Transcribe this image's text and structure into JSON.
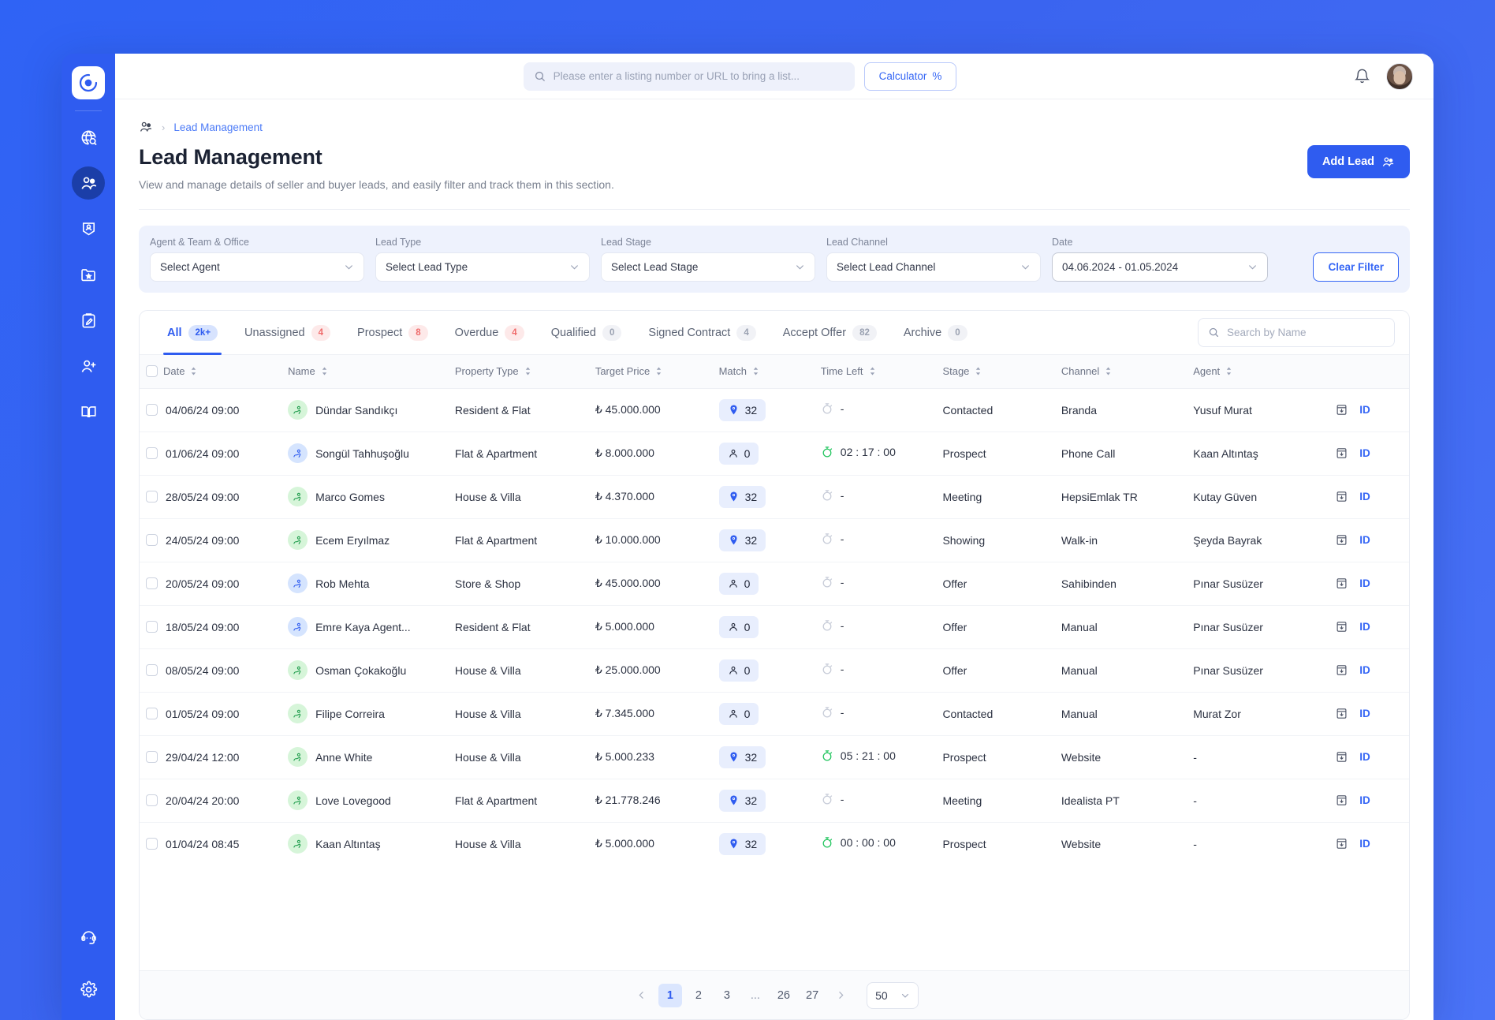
{
  "brand": {
    "logo_icon": "target-logo-icon"
  },
  "sidebar": {
    "items": [
      {
        "name": "sidebar-item-discover",
        "icon": "globe-search-icon",
        "active": false
      },
      {
        "name": "sidebar-item-leads",
        "icon": "users-icon",
        "active": true
      },
      {
        "name": "sidebar-item-portfolio",
        "icon": "badge-person-icon",
        "active": false
      },
      {
        "name": "sidebar-item-favorites",
        "icon": "folder-star-icon",
        "active": false
      },
      {
        "name": "sidebar-item-notes",
        "icon": "clipboard-edit-icon",
        "active": false
      },
      {
        "name": "sidebar-item-add-user",
        "icon": "user-plus-icon",
        "active": false
      },
      {
        "name": "sidebar-item-library",
        "icon": "book-icon",
        "active": false
      }
    ],
    "bottom": [
      {
        "name": "sidebar-item-support",
        "icon": "headset-icon"
      },
      {
        "name": "sidebar-item-settings",
        "icon": "gear-icon"
      }
    ]
  },
  "topbar": {
    "search": {
      "value": "",
      "placeholder": "Please enter a listing number or URL to bring a list..."
    },
    "calculator_label": "Calculator",
    "calculator_symbol": "%",
    "notification_icon": "bell-icon",
    "avatar_icon": "user-avatar"
  },
  "breadcrumb": {
    "icon": "users-icon",
    "separator": "›",
    "current": "Lead Management"
  },
  "page": {
    "title": "Lead Management",
    "subtitle": "View and manage details of seller and buyer leads, and easily filter and track them in this section.",
    "add_lead_label": "Add Lead"
  },
  "filters": {
    "agent": {
      "label": "Agent & Team & Office",
      "value": "Select Agent"
    },
    "type": {
      "label": "Lead Type",
      "value": "Select Lead Type"
    },
    "stage": {
      "label": "Lead Stage",
      "value": "Select Lead Stage"
    },
    "channel": {
      "label": "Lead Channel",
      "value": "Select Lead Channel"
    },
    "date": {
      "label": "Date",
      "value": "04.06.2024 - 01.05.2024"
    },
    "clear_label": "Clear Filter"
  },
  "tabs": [
    {
      "label": "All",
      "count": "2k+",
      "style": "blue",
      "active": true
    },
    {
      "label": "Unassigned",
      "count": "4",
      "style": "red",
      "active": false
    },
    {
      "label": "Prospect",
      "count": "8",
      "style": "red",
      "active": false
    },
    {
      "label": "Overdue",
      "count": "4",
      "style": "red",
      "active": false
    },
    {
      "label": "Qualified",
      "count": "0",
      "style": "gray",
      "active": false
    },
    {
      "label": "Signed Contract",
      "count": "4",
      "style": "gray",
      "active": false
    },
    {
      "label": "Accept Offer",
      "count": "82",
      "style": "gray",
      "active": false
    },
    {
      "label": "Archive",
      "count": "0",
      "style": "gray",
      "active": false
    }
  ],
  "table_search": {
    "value": "",
    "placeholder": "Search by Name"
  },
  "table": {
    "columns": [
      "Date",
      "Name",
      "Property Type",
      "Target Price",
      "Match",
      "Time Left",
      "Stage",
      "Channel",
      "Agent"
    ],
    "id_label": "ID",
    "rows": [
      {
        "date": "04/06/24 09:00",
        "name": "Dündar Sandıkçı",
        "lead_type": "seller",
        "property": "Resident & Flat",
        "price": "₺ 45.000.000",
        "match": "32",
        "match_icon": "pin-icon",
        "time": "-",
        "timer_active": false,
        "stage": "Contacted",
        "channel": "Branda",
        "agent": "Yusuf Murat"
      },
      {
        "date": "01/06/24 09:00",
        "name": "Songül Tahhuşoğlu",
        "lead_type": "buyer",
        "property": "Flat & Apartment",
        "price": "₺ 8.000.000",
        "match": "0",
        "match_icon": "person-icon",
        "time": "02 : 17 : 00",
        "timer_active": true,
        "stage": "Prospect",
        "channel": "Phone Call",
        "agent": "Kaan Altıntaş"
      },
      {
        "date": "28/05/24 09:00",
        "name": "Marco Gomes",
        "lead_type": "seller",
        "property": "House & Villa",
        "price": "₺ 4.370.000",
        "match": "32",
        "match_icon": "pin-icon",
        "time": "-",
        "timer_active": false,
        "stage": "Meeting",
        "channel": "HepsiEmlak TR",
        "agent": "Kutay Güven"
      },
      {
        "date": "24/05/24 09:00",
        "name": "Ecem Eryılmaz",
        "lead_type": "seller",
        "property": "Flat & Apartment",
        "price": "₺ 10.000.000",
        "match": "32",
        "match_icon": "pin-icon",
        "time": "-",
        "timer_active": false,
        "stage": "Showing",
        "channel": "Walk-in",
        "agent": "Şeyda Bayrak"
      },
      {
        "date": "20/05/24 09:00",
        "name": "Rob Mehta",
        "lead_type": "buyer",
        "property": "Store & Shop",
        "price": "₺ 45.000.000",
        "match": "0",
        "match_icon": "person-icon",
        "time": "-",
        "timer_active": false,
        "stage": "Offer",
        "channel": "Sahibinden",
        "agent": "Pınar Susüzer"
      },
      {
        "date": "18/05/24 09:00",
        "name": "Emre Kaya Agent...",
        "lead_type": "buyer",
        "property": "Resident & Flat",
        "price": "₺ 5.000.000",
        "match": "0",
        "match_icon": "person-icon",
        "time": "-",
        "timer_active": false,
        "stage": "Offer",
        "channel": "Manual",
        "agent": "Pınar Susüzer"
      },
      {
        "date": "08/05/24 09:00",
        "name": "Osman Çokakoğlu",
        "lead_type": "seller",
        "property": "House & Villa",
        "price": "₺ 25.000.000",
        "match": "0",
        "match_icon": "person-icon",
        "time": "-",
        "timer_active": false,
        "stage": "Offer",
        "channel": "Manual",
        "agent": "Pınar Susüzer"
      },
      {
        "date": "01/05/24 09:00",
        "name": "Filipe Correira",
        "lead_type": "seller",
        "property": "House & Villa",
        "price": "₺ 7.345.000",
        "match": "0",
        "match_icon": "person-icon",
        "time": "-",
        "timer_active": false,
        "stage": "Contacted",
        "channel": "Manual",
        "agent": "Murat Zor"
      },
      {
        "date": "29/04/24 12:00",
        "name": "Anne White",
        "lead_type": "seller",
        "property": "House & Villa",
        "price": "₺ 5.000.233",
        "match": "32",
        "match_icon": "pin-icon",
        "time": "05 : 21 : 00",
        "timer_active": true,
        "stage": "Prospect",
        "channel": "Website",
        "agent": "-"
      },
      {
        "date": "20/04/24 20:00",
        "name": "Love Lovegood",
        "lead_type": "seller",
        "property": "Flat & Apartment",
        "price": "₺ 21.778.246",
        "match": "32",
        "match_icon": "pin-icon",
        "time": "-",
        "timer_active": false,
        "stage": "Meeting",
        "channel": "Idealista PT",
        "agent": "-"
      },
      {
        "date": "01/04/24 08:45",
        "name": "Kaan Altıntaş",
        "lead_type": "seller",
        "property": "House & Villa",
        "price": "₺ 5.000.000",
        "match": "32",
        "match_icon": "pin-icon",
        "time": "00 : 00 : 00",
        "timer_active": true,
        "stage": "Prospect",
        "channel": "Website",
        "agent": "-"
      }
    ]
  },
  "pagination": {
    "prev_icon": "chevron-left-icon",
    "next_icon": "chevron-right-icon",
    "pages": [
      "1",
      "2",
      "3",
      "...",
      "26",
      "27"
    ],
    "current": "1",
    "page_size": "50"
  },
  "colors": {
    "brand_blue": "#2f5cf0",
    "link_blue": "#3566f5",
    "sidebar_blue": "#2f5cf0",
    "seller_green": "#d6f5d9",
    "buyer_blue": "#d5e4fe",
    "timer_green": "#22c55e",
    "badge_red_bg": "#fde9e9"
  }
}
